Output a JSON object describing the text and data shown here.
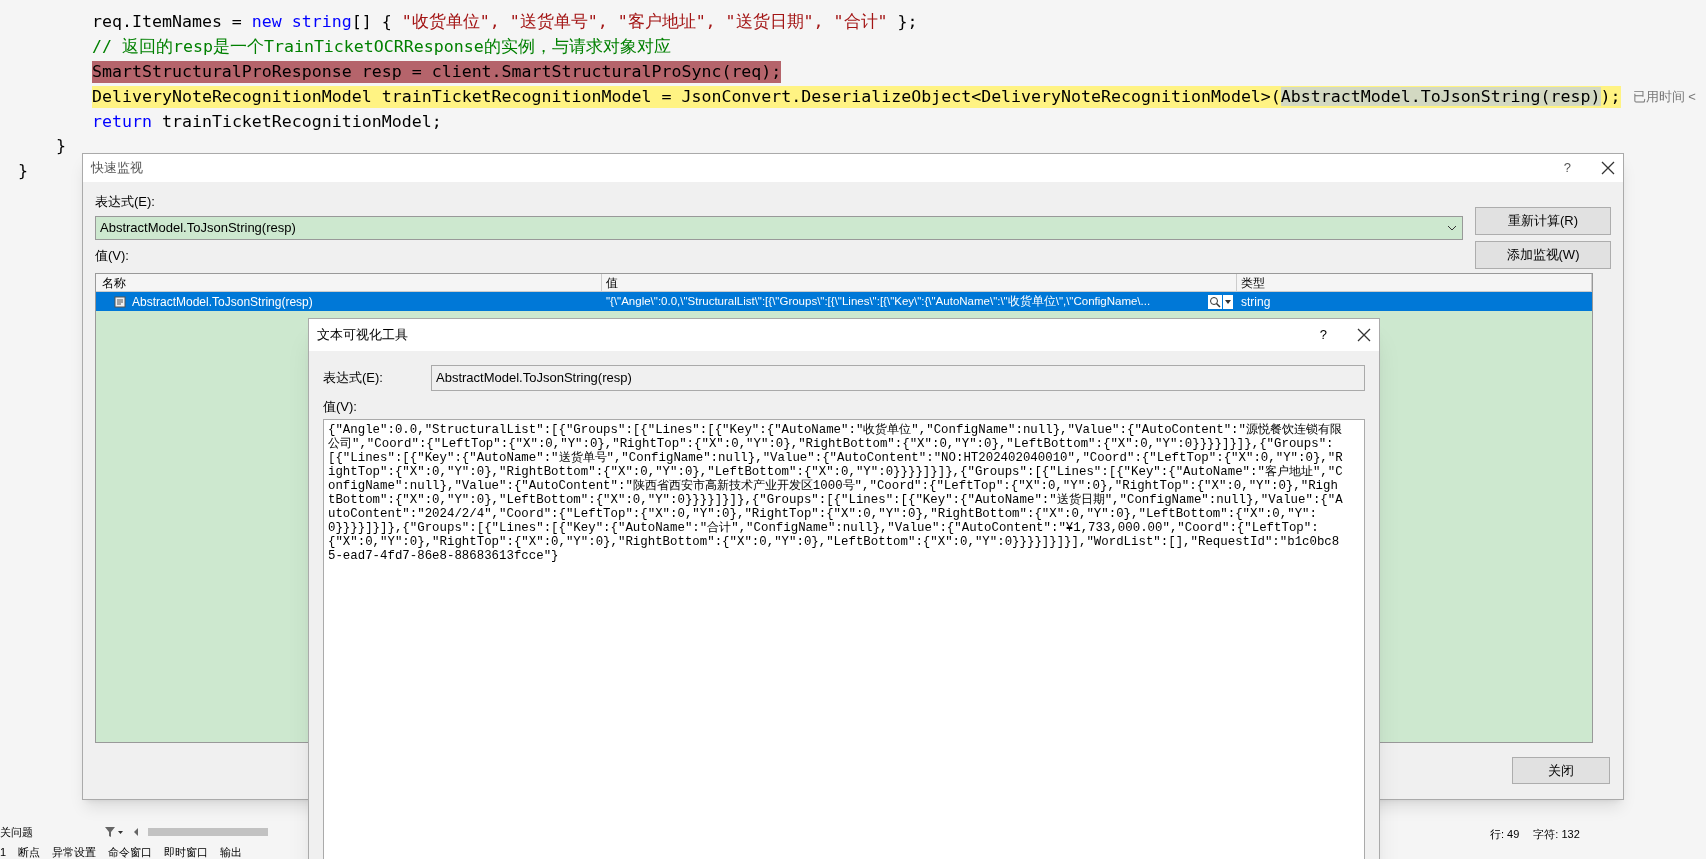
{
  "editor": {
    "lines": [
      {
        "breakpoint": false,
        "current": false,
        "tokens": [
          {
            "kind": "plain",
            "text": "req.ItemNames = "
          },
          {
            "kind": "keyword",
            "text": "new string"
          },
          {
            "kind": "plain",
            "text": "[] { "
          },
          {
            "kind": "string",
            "text": "\"收货单位\", \"送货单号\", \"客户地址\", \"送货日期\", \"合计\""
          },
          {
            "kind": "plain",
            "text": " };"
          }
        ]
      },
      {
        "breakpoint": false,
        "current": false,
        "tokens": [
          {
            "kind": "comment",
            "text": "// 返回的resp是一个TrainTicketOCRResponse的实例，与请求对象对应"
          }
        ]
      },
      {
        "breakpoint": true,
        "current": false,
        "tokens": [
          {
            "kind": "plain",
            "text": "SmartStructuralProResponse resp = client.SmartStructuralProSync(req);"
          }
        ]
      },
      {
        "breakpoint": false,
        "current": true,
        "hint": "已用时间 <",
        "tokens": [
          {
            "kind": "plain",
            "text": "DeliveryNoteRecognitionModel trainTicketRecognitionModel = JsonConvert.DeserializeObject<DeliveryNoteRecognitionModel>("
          },
          {
            "kind": "selected",
            "text": "AbstractModel.ToJsonString(resp)"
          },
          {
            "kind": "plain",
            "text": ");"
          }
        ]
      },
      {
        "breakpoint": false,
        "current": false,
        "tokens": [
          {
            "kind": "keyword",
            "text": "return"
          },
          {
            "kind": "plain",
            "text": " trainTicketRecognitionModel;"
          }
        ]
      }
    ],
    "closing_braces": [
      "}",
      "}"
    ]
  },
  "quick_watch": {
    "title": "快速监视",
    "help": "?",
    "expression_label": "表达式(E):",
    "expression": "AbstractModel.ToJsonString(resp)",
    "buttons": [
      "重新计算(R)",
      "添加监视(W)"
    ],
    "value_label": "值(V):",
    "columns": [
      "名称",
      "值",
      "类型"
    ],
    "rows": [
      {
        "name": "AbstractModel.ToJsonString(resp)",
        "value": "\"{\\\"Angle\\\":0.0,\\\"StructuralList\\\":[{\\\"Groups\\\":[{\\\"Lines\\\":[{\\\"Key\\\":{\\\"AutoName\\\":\\\"收货单位\\\",\\\"ConfigName\\...",
        "type": "string",
        "selected": true
      }
    ],
    "close_button": "关闭"
  },
  "text_visualizer": {
    "title": "文本可视化工具",
    "help": "?",
    "expression_label": "表达式(E):",
    "expression": "AbstractModel.ToJsonString(resp)",
    "value_label": "值(V):",
    "value": "{\"Angle\":0.0,\"StructuralList\":[{\"Groups\":[{\"Lines\":[{\"Key\":{\"AutoName\":\"收货单位\",\"ConfigName\":null},\"Value\":{\"AutoContent\":\"源悦餐饮连锁有限公司\",\"Coord\":{\"LeftTop\":{\"X\":0,\"Y\":0},\"RightTop\":{\"X\":0,\"Y\":0},\"RightBottom\":{\"X\":0,\"Y\":0},\"LeftBottom\":{\"X\":0,\"Y\":0}}}}]}]},{\"Groups\":[{\"Lines\":[{\"Key\":{\"AutoName\":\"送货单号\",\"ConfigName\":null},\"Value\":{\"AutoContent\":\"NO:HT202402040010\",\"Coord\":{\"LeftTop\":{\"X\":0,\"Y\":0},\"RightTop\":{\"X\":0,\"Y\":0},\"RightBottom\":{\"X\":0,\"Y\":0},\"LeftBottom\":{\"X\":0,\"Y\":0}}}}]}]},{\"Groups\":[{\"Lines\":[{\"Key\":{\"AutoName\":\"客户地址\",\"ConfigName\":null},\"Value\":{\"AutoContent\":\"陕西省西安市高新技术产业开发区1000号\",\"Coord\":{\"LeftTop\":{\"X\":0,\"Y\":0},\"RightTop\":{\"X\":0,\"Y\":0},\"RightBottom\":{\"X\":0,\"Y\":0},\"LeftBottom\":{\"X\":0,\"Y\":0}}}}]}]},{\"Groups\":[{\"Lines\":[{\"Key\":{\"AutoName\":\"送货日期\",\"ConfigName\":null},\"Value\":{\"AutoContent\":\"2024/2/4\",\"Coord\":{\"LeftTop\":{\"X\":0,\"Y\":0},\"RightTop\":{\"X\":0,\"Y\":0},\"RightBottom\":{\"X\":0,\"Y\":0},\"LeftBottom\":{\"X\":0,\"Y\":0}}}}]}]},{\"Groups\":[{\"Lines\":[{\"Key\":{\"AutoName\":\"合计\",\"ConfigName\":null},\"Value\":{\"AutoContent\":\"¥1,733,000.00\",\"Coord\":{\"LeftTop\":{\"X\":0,\"Y\":0},\"RightTop\":{\"X\":0,\"Y\":0},\"RightBottom\":{\"X\":0,\"Y\":0},\"LeftBottom\":{\"X\":0,\"Y\":0}}}}]}]}],\"WordList\":[],\"RequestId\":\"b1c0bc85-ead7-4fd7-86e8-88683613fcce\"}"
  },
  "status": {
    "panel_title": "关问题",
    "tabs": [
      "1",
      "断点",
      "异常设置",
      "命令窗口",
      "即时窗口",
      "输出"
    ],
    "position": [
      "行: 49",
      "字符: 132"
    ]
  }
}
